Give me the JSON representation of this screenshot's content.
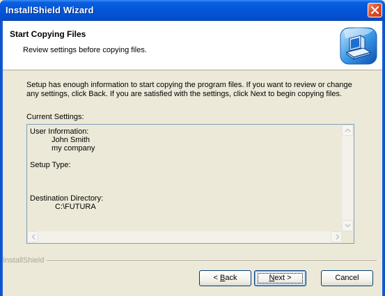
{
  "window": {
    "title": "InstallShield Wizard"
  },
  "header": {
    "title": "Start Copying Files",
    "subtitle": "Review settings before copying files."
  },
  "body": {
    "text": "Setup has enough information to start copying the program files.  If you want to review or change any settings, click Back.  If you are satisfied with the settings, click Next to begin copying files.",
    "settings_label": "Current Settings:"
  },
  "settings": {
    "user_info_label": "User Information:",
    "user_name": "John Smith",
    "company": "my company",
    "setup_type_label": "Setup Type:",
    "destination_label": "Destination Directory:",
    "destination": "C:\\FUTURA"
  },
  "footer": {
    "brand": "InstallShield"
  },
  "buttons": {
    "back_prefix": "< ",
    "back_mnemonic": "B",
    "back_rest": "ack",
    "next_mnemonic": "N",
    "next_rest": "ext >",
    "cancel": "Cancel"
  }
}
